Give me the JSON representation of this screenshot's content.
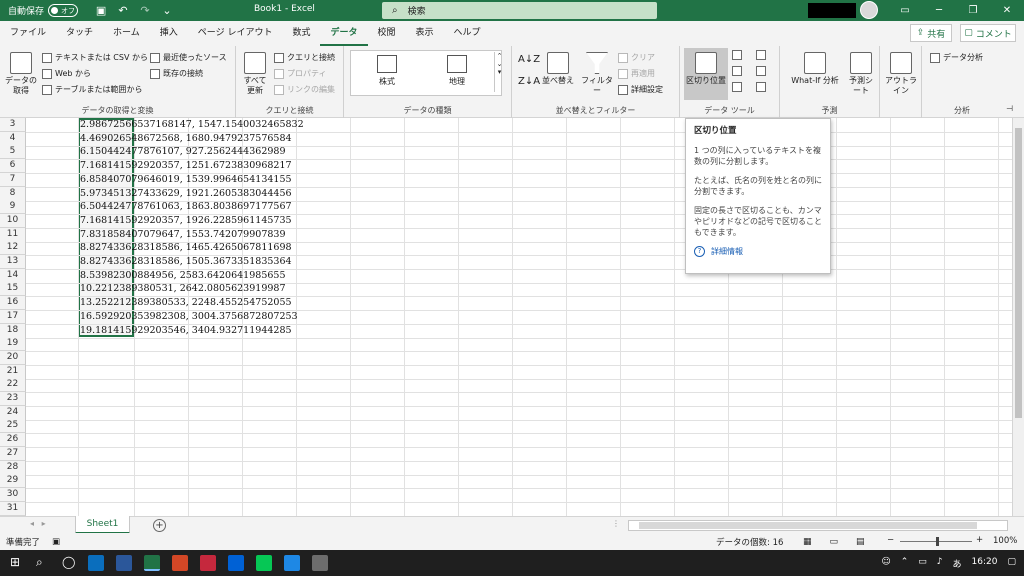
{
  "titlebar": {
    "autosave_label": "自動保存",
    "autosave_state": "オフ",
    "document_title": "Book1  -  Excel",
    "search_placeholder": "検索"
  },
  "tabs": [
    "ファイル",
    "タッチ",
    "ホーム",
    "挿入",
    "ページ レイアウト",
    "数式",
    "データ",
    "校閲",
    "表示",
    "ヘルプ"
  ],
  "active_tab": "データ",
  "share_label": "共有",
  "comment_label": "コメント",
  "ribbon": {
    "get_data": {
      "label": "データの取得と変換",
      "big_button": "データの取得",
      "text_csv": "テキストまたは CSV から",
      "web": "Web から",
      "table_range": "テーブルまたは範囲から",
      "recent_sources": "最近使ったソース",
      "existing_connections": "既存の接続"
    },
    "queries": {
      "label": "クエリと接続",
      "refresh_all": "すべて更新",
      "queries_connections": "クエリと接続",
      "properties": "プロパティ",
      "edit_links": "リンクの編集"
    },
    "data_types": {
      "label": "データの種類",
      "stocks": "株式",
      "geography": "地理"
    },
    "sort_filter": {
      "label": "並べ替えとフィルター",
      "sort": "並べ替え",
      "filter": "フィルター",
      "clear": "クリア",
      "reapply": "再適用",
      "advanced": "詳細設定"
    },
    "data_tools": {
      "label": "データ ツール",
      "text_to_columns": "区切り位置"
    },
    "forecast": {
      "label": "予測",
      "what_if": "What-If 分析",
      "forecast_sheet": "予測シート"
    },
    "outline": {
      "label": "アウトライン",
      "button": "アウトライン"
    },
    "analysis": {
      "label": "分析",
      "data_analysis": "データ分析"
    }
  },
  "grid": {
    "row_numbers": [
      "3",
      "4",
      "5",
      "6",
      "7",
      "8",
      "9",
      "10",
      "11",
      "12",
      "13",
      "14",
      "15",
      "16",
      "17",
      "18",
      "19",
      "20",
      "21",
      "22",
      "23",
      "24",
      "25",
      "26",
      "27",
      "28",
      "29",
      "30",
      "31"
    ],
    "cells": [
      "2.98672566537168147, 1547.1540032465832",
      "4.46902654867256​8, 1680.9479237576584",
      "6.15044247787610​7, 927.2562444362989",
      "7.16814159292035​7, 1251.6723830968217",
      "6.85840707964601​9, 1539.9964654134155",
      "5.97345132743362​9, 1921.2605383044456",
      "6.50442477876106​3, 1863.8038697177567",
      "7.16814159292035​7, 1926.2285961145735",
      "7.83185840707964​7, 1553.742079907839",
      "8.82743362831858​6, 1465.4265067811698",
      "8.82743362831858​6, 1505.3673351835364",
      "8.53982300884956, 2583.6420641985655",
      "10.2212389380531, 2642.0805623919987",
      "13.2522123893805​33, 2248.455254752055",
      "16.5929203539823​08, 3004.3756872807253",
      "19.1814159292035​46, 3404.932711944285"
    ]
  },
  "tooltip": {
    "title": "区切り位置",
    "p1": "1 つの列に入っているテキストを複数の列に分割します。",
    "p2": "たとえば、氏名の列を姓と名の列に分割できます。",
    "p3": "固定の長さで区切ることも、カンマやピリオドなどの記号で区切ることもできます。",
    "more": "詳細情報"
  },
  "sheet": {
    "name": "Sheet1"
  },
  "status": {
    "ready": "準備完了",
    "count": "データの個数: 16",
    "zoom": "100%"
  },
  "taskbar": {
    "time": "16:20"
  }
}
